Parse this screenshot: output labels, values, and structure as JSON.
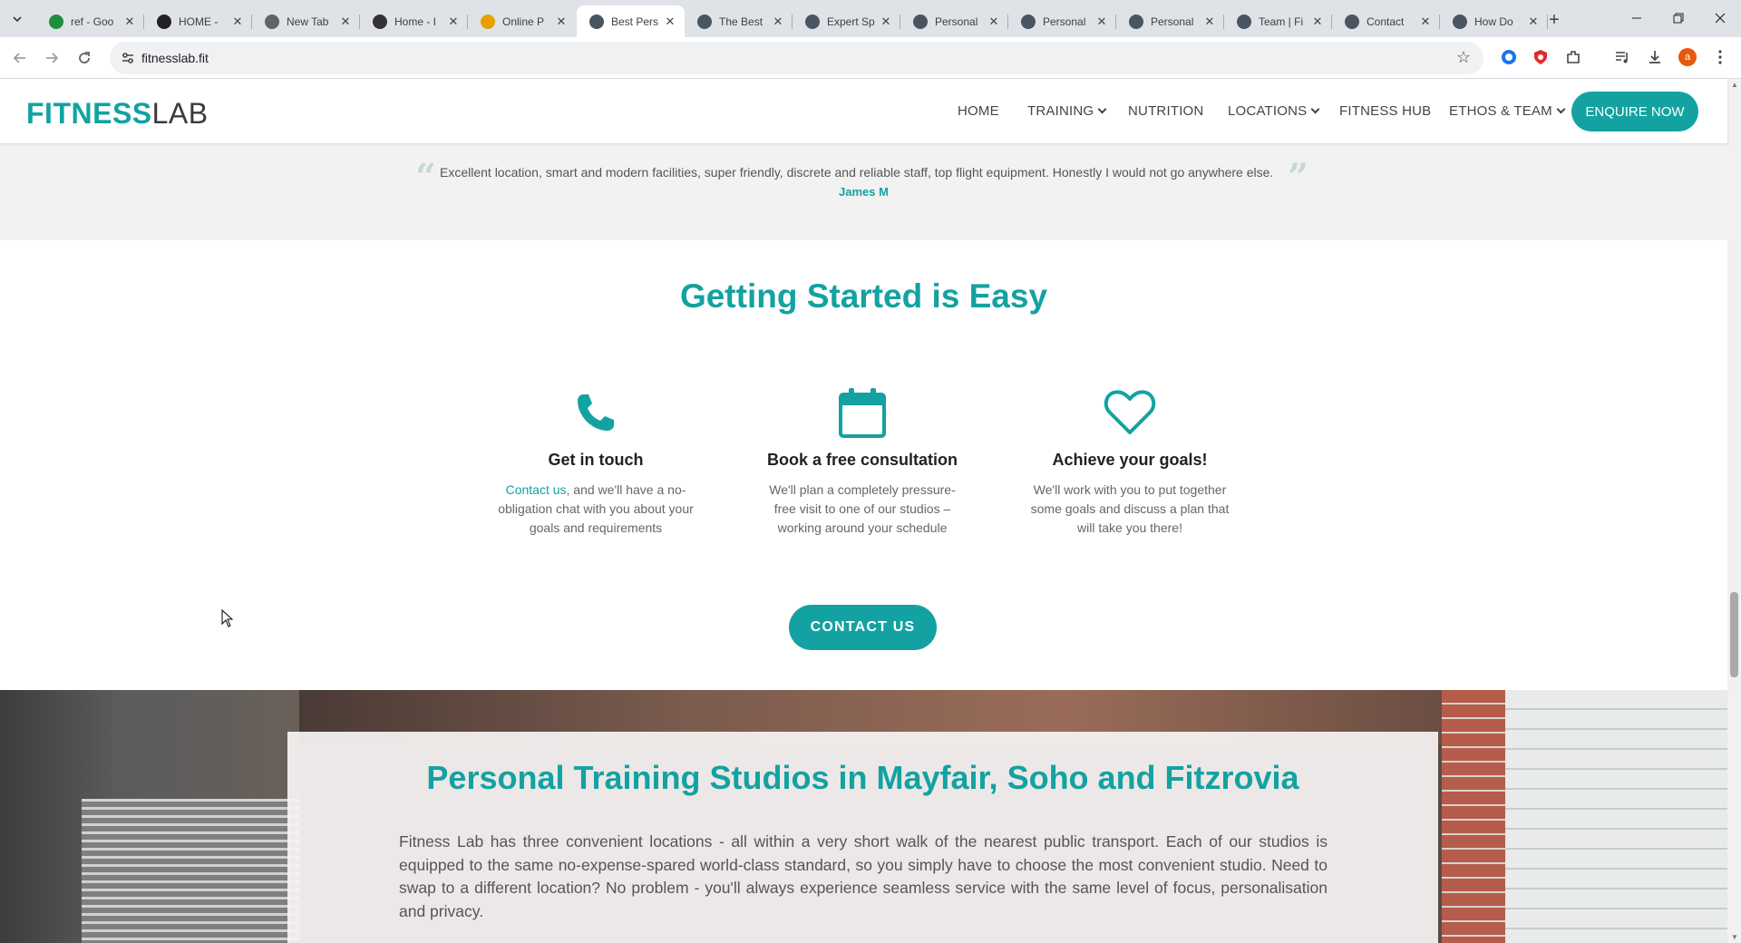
{
  "browser": {
    "tabs": [
      {
        "title": "ref - Goo",
        "favicon": "sheets-icon",
        "color": "#1e8e3e"
      },
      {
        "title": "HOME -",
        "favicon": "trm-icon",
        "color": "#222222"
      },
      {
        "title": "New Tab",
        "favicon": "chrome-icon",
        "color": "#5f6368"
      },
      {
        "title": "Home - I",
        "favicon": "site-icon",
        "color": "#333333"
      },
      {
        "title": "Online P",
        "favicon": "figure-icon",
        "color": "#e6a100"
      },
      {
        "title": "Best Pers",
        "favicon": "fitnesslab-icon",
        "color": "#4a5562",
        "active": true
      },
      {
        "title": "The Best",
        "favicon": "fitnesslab-icon",
        "color": "#4a5562"
      },
      {
        "title": "Expert Sp",
        "favicon": "fitnesslab-icon",
        "color": "#4a5562"
      },
      {
        "title": "Personal",
        "favicon": "fitnesslab-icon",
        "color": "#4a5562"
      },
      {
        "title": "Personal",
        "favicon": "fitnesslab-icon",
        "color": "#4a5562"
      },
      {
        "title": "Personal",
        "favicon": "fitnesslab-icon",
        "color": "#4a5562"
      },
      {
        "title": "Team | Fi",
        "favicon": "fitnesslab-icon",
        "color": "#4a5562"
      },
      {
        "title": "Contact",
        "favicon": "fitnesslab-icon",
        "color": "#4a5562"
      },
      {
        "title": "How Do",
        "favicon": "fitnesslab-icon",
        "color": "#4a5562"
      }
    ],
    "url": "fitnesslab.fit",
    "profile_initial": "a"
  },
  "header": {
    "logo_bold": "FITNESS",
    "logo_light": "LAB",
    "nav": [
      {
        "label": "HOME",
        "dropdown": false
      },
      {
        "label": "TRAINING",
        "dropdown": true
      },
      {
        "label": "NUTRITION",
        "dropdown": false
      },
      {
        "label": "LOCATIONS",
        "dropdown": true
      },
      {
        "label": "FITNESS HUB",
        "dropdown": false
      },
      {
        "label": "ETHOS & TEAM",
        "dropdown": true
      }
    ],
    "cta": "ENQUIRE NOW"
  },
  "testimonial": {
    "quote": "Excellent location, smart and modern facilities, super friendly, discrete and reliable staff, top flight equipment. Honestly I would not go anywhere else.",
    "author": "James M"
  },
  "getting_started": {
    "title": "Getting Started is Easy",
    "steps": [
      {
        "icon": "phone-icon",
        "title": "Get in touch",
        "link": "Contact us",
        "text": ", and we'll have a no-obligation chat with you about your goals and requirements"
      },
      {
        "icon": "calendar-icon",
        "title": "Book a free consultation",
        "text": "We'll plan a completely pressure-free visit to one of our studios – working around your schedule"
      },
      {
        "icon": "heart-icon",
        "title": "Achieve your goals!",
        "text": "We'll work with you to put together some goals and discuss a plan that will take you there!"
      }
    ],
    "button": "CONTACT US"
  },
  "studios": {
    "title": "Personal Training Studios in Mayfair, Soho and Fitzrovia",
    "text": "Fitness Lab has three convenient locations - all within a very short walk of the nearest public transport. Each of our studios is equipped to the same no-expense-spared world-class standard, so you simply have to choose the most convenient studio. Need to swap to a different location? No problem - you'll always experience seamless service with the same level of focus, personalisation and privacy."
  },
  "colors": {
    "brand_teal": "#13a2a1",
    "tab_strip": "#dfe3e8",
    "testimonial_bg": "#f2f2f2"
  }
}
